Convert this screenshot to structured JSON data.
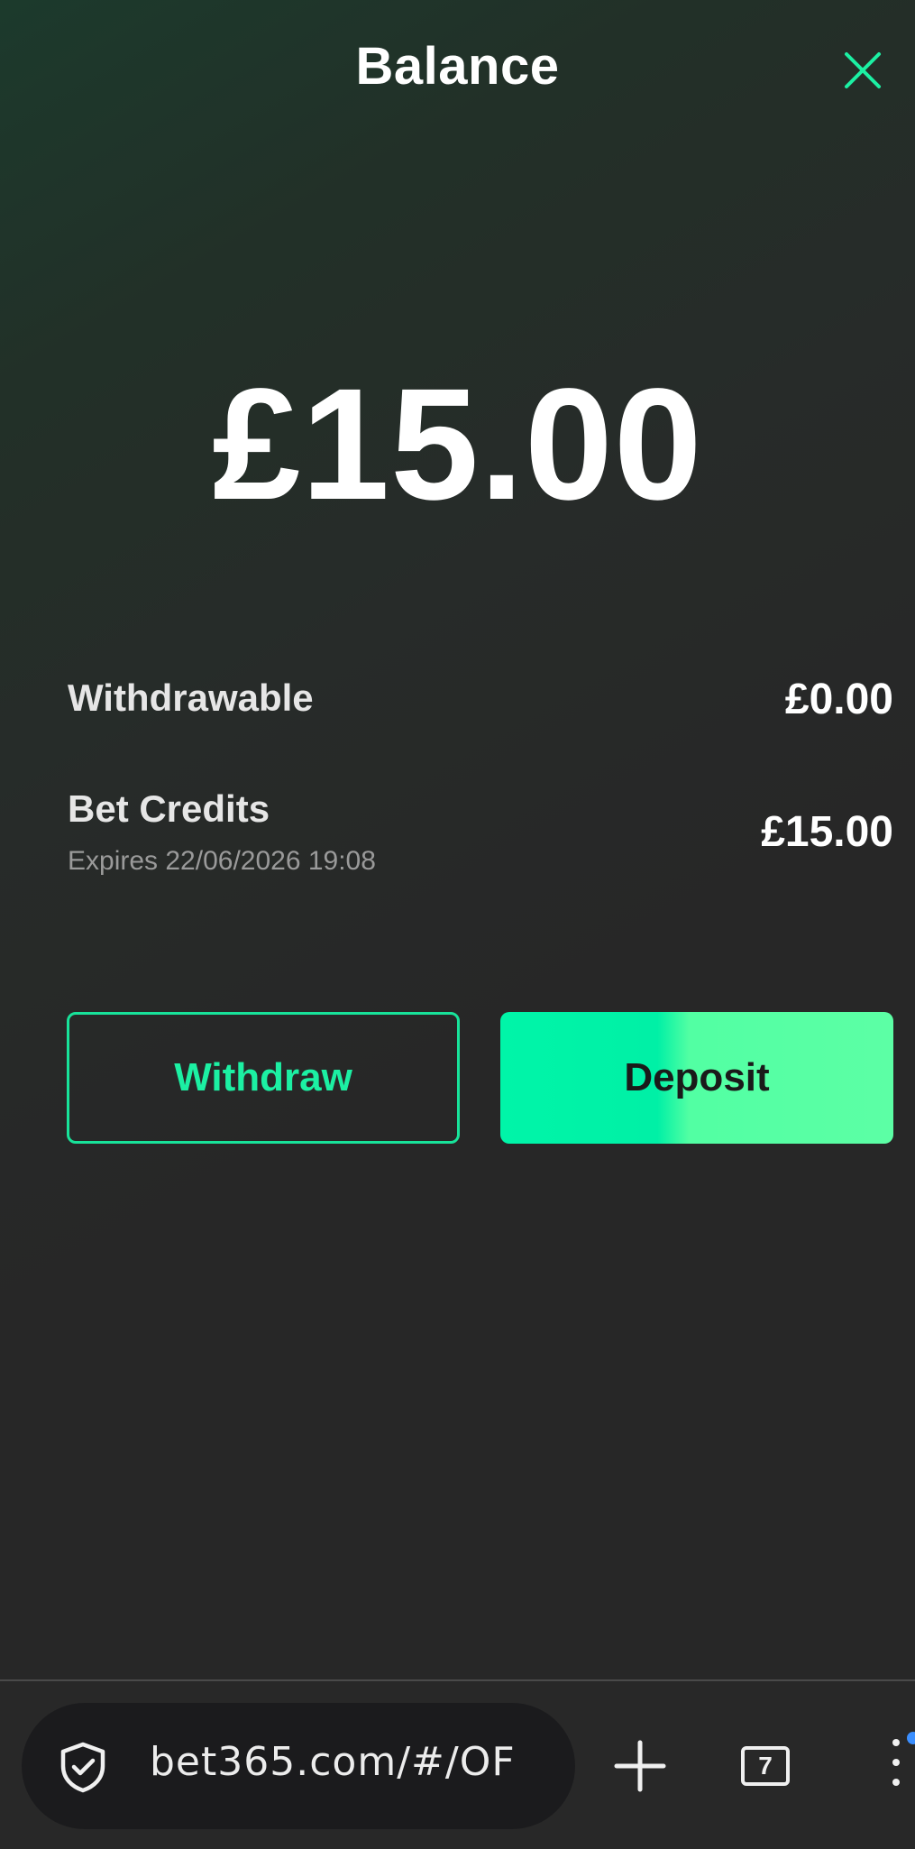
{
  "header": {
    "title": "Balance",
    "close_icon": "close-icon",
    "accent_color": "#1cf0a3"
  },
  "balance": {
    "total": "£15.00"
  },
  "rows": {
    "withdrawable_label": "Withdrawable",
    "withdrawable_value": "£0.00",
    "bet_credits_label": "Bet Credits",
    "bet_credits_value": "£15.00",
    "bet_credits_expiry": "Expires 22/06/2026 19:08"
  },
  "actions": {
    "withdraw_label": "Withdraw",
    "deposit_label": "Deposit"
  },
  "browser": {
    "url": "bet365.com/#/OF",
    "tab_count": "7",
    "shield_icon": "shield-check-icon",
    "plus_icon": "plus-icon",
    "menu_icon": "more-vert-icon"
  }
}
